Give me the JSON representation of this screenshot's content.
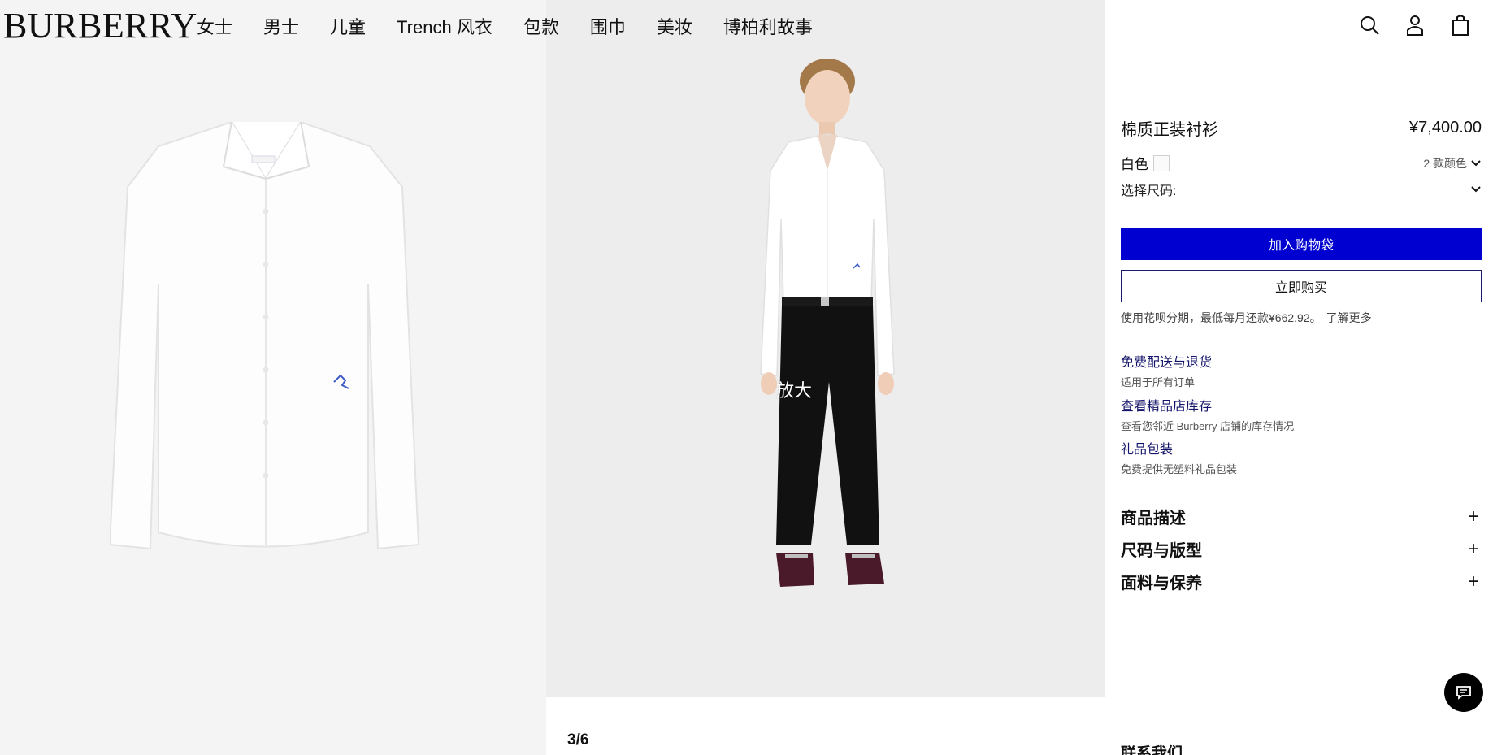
{
  "header": {
    "logo": "BURBERRY",
    "nav": [
      "女士",
      "男士",
      "儿童",
      "Trench 风衣",
      "包款",
      "围巾",
      "美妆",
      "博柏利故事"
    ],
    "icons": [
      "search-icon",
      "account-icon",
      "shopping-bag-icon"
    ]
  },
  "gallery": {
    "zoom_label": "放大",
    "counter": "3/6"
  },
  "product": {
    "title": "棉质正装衬衫",
    "price": "¥7,400.00",
    "color_label": "白色",
    "color_swatch": "#fafafa",
    "color_count": "2 款颜色",
    "size_label": "选择尺码:",
    "add_to_bag": "加入购物袋",
    "buy_now": "立即购买",
    "installment_text": "使用花呗分期，最低每月还款¥662.92。",
    "installment_link": "了解更多"
  },
  "services": [
    {
      "title": "免费配送与退货",
      "subtitle": "适用于所有订单"
    },
    {
      "title": "查看精品店库存",
      "subtitle": "查看您邻近 Burberry 店铺的库存情况"
    },
    {
      "title": "礼品包装",
      "subtitle": "免费提供无塑料礼品包装"
    }
  ],
  "accordions": [
    {
      "label": "商品描述"
    },
    {
      "label": "尺码与版型"
    },
    {
      "label": "面料与保养"
    }
  ],
  "footer": {
    "contact": "联系我们"
  },
  "colors": {
    "accent_blue": "#0000d1",
    "link_blue": "#14146b"
  }
}
